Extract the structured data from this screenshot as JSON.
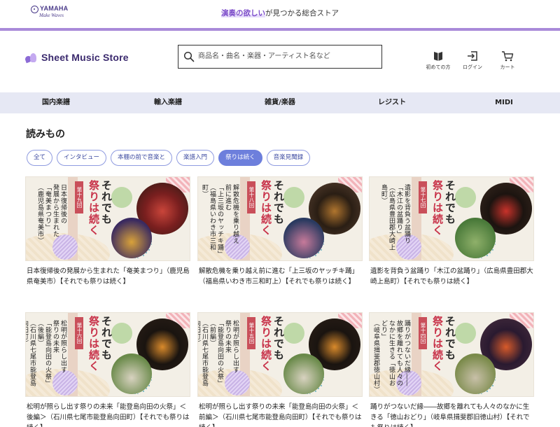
{
  "topbar": {
    "brand_name": "YAMAHA",
    "brand_sub": "Make Waves",
    "tagline_highlight": "演奏の欲しい",
    "tagline_rest": "が見つかる総合ストア"
  },
  "header": {
    "store_name": "Sheet Music Store",
    "search_placeholder": "商品名・曲名・楽器・アーティスト名など",
    "icons": [
      {
        "name": "book-icon",
        "label": "初めての方"
      },
      {
        "name": "login-icon",
        "label": "ログイン"
      },
      {
        "name": "cart-icon",
        "label": "カート"
      }
    ]
  },
  "nav": {
    "items": [
      "国内楽譜",
      "輸入楽譜",
      "雑貨/楽器",
      "レジスト",
      "MIDI"
    ]
  },
  "main": {
    "title": "読みもの",
    "chips": [
      {
        "label": "全て",
        "active": false
      },
      {
        "label": "インタビュー",
        "active": false
      },
      {
        "label": "本棚の前で音楽と",
        "active": false
      },
      {
        "label": "楽譜入門",
        "active": false
      },
      {
        "label": "祭りは続く",
        "active": true
      },
      {
        "label": "音楽見聞録",
        "active": false
      }
    ],
    "series_title_1": "それでも",
    "series_title_2": "祭りは続く",
    "articles": [
      {
        "episode": "第十九回",
        "thumb_text": [
          "日本復帰後の",
          "発展から生まれた",
          "「奄美まつり」",
          "（鹿児島県奄美市）"
        ],
        "title": "日本復帰後の発展から生まれた「奄美まつり」（鹿児島県奄美市）【それでも祭りは続く】"
      },
      {
        "episode": "第十八回",
        "thumb_text": [
          "解散危機を乗り越え",
          "前に進む",
          "「上三坂のヤッチキ踊」",
          "（福島県いわき市三和町）"
        ],
        "title": "解散危機を乗り越え前に進む「上三坂のヤッチキ踊」（福島県いわき市三和町上）【それでも祭りは続く】"
      },
      {
        "episode": "第十七回",
        "thumb_text": [
          "遺影を背負う盆踊り",
          "「木江の盆踊り」",
          "（広島県豊田郡大崎上島町）"
        ],
        "title": "遺影を背負う盆踊り「木江の盆踊り」（広島県豊田郡大崎上島町）【それでも祭りは続く】"
      },
      {
        "episode": "第十六回",
        "thumb_text": [
          "松明が照らし出す",
          "祭りの未来",
          "「能登島向田の火祭」（後編）",
          "（石川県七尾市能登島向田町）"
        ],
        "title": "松明が照らし出す祭りの未来「能登島向田の火祭」＜後編＞（石川県七尾市能登島向田町）【それでも祭りは続く】"
      },
      {
        "episode": "第十五回",
        "thumb_text": [
          "松明が照らし出す",
          "祭りの未来",
          "「能登島向田の火祭」（前編）",
          "（石川県七尾市能登島向田町）"
        ],
        "title": "松明が照らし出す祭りの未来「能登島向田の火祭」＜前編＞（石川県七尾市能登島向田町）【それでも祭りは続く】"
      },
      {
        "episode": "第十四回",
        "thumb_text": [
          "踊りがつないだ縁――",
          "故郷を離れても人々の",
          "なかに生きる「徳山おどり」",
          "（岐阜県揖斐郡徳山村）"
        ],
        "title": "踊りがつないだ縁――故郷を離れても人々のなかに生きる「徳山おどり」（岐阜県揖斐郡旧徳山村）【それでも祭りは続く】"
      }
    ]
  },
  "colors": {
    "accent_purple": "#a98ad9",
    "nav_bg": "#e6e8f4",
    "chip_active": "#6d7fdc",
    "episode_red": "#c94f5a"
  }
}
